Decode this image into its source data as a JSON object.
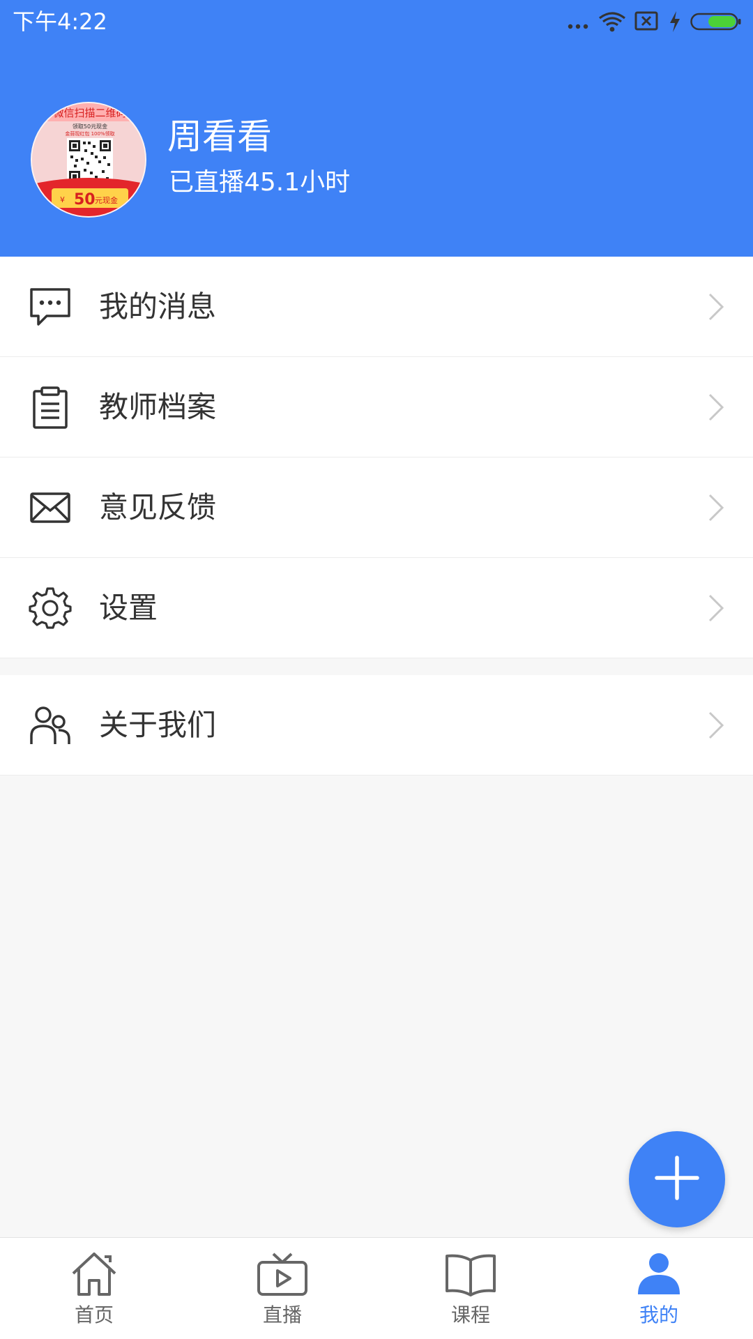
{
  "status_bar": {
    "time": "下午4:22",
    "icons": [
      "more-dots-icon",
      "wifi-icon",
      "no-sim-icon",
      "charging-icon",
      "battery-icon"
    ],
    "battery_color": "#4cd137"
  },
  "profile": {
    "name": "周看看",
    "live_hours": "已直播45.1小时",
    "avatar_icon": "qr-code-avatar-image",
    "avatar_texts": {
      "top_banner": "微信扫描二维码",
      "line1": "领取50元现金",
      "line2": "金蒜现红包  100%领取",
      "coupon_symbol": "¥",
      "coupon_amount": "50",
      "coupon_unit": "元现金"
    }
  },
  "menu": {
    "group1": [
      {
        "label": "我的消息",
        "icon": "message-icon"
      },
      {
        "label": "教师档案",
        "icon": "clipboard-icon"
      },
      {
        "label": "意见反馈",
        "icon": "envelope-icon"
      },
      {
        "label": "设置",
        "icon": "gear-icon"
      }
    ],
    "group2": [
      {
        "label": "关于我们",
        "icon": "users-icon"
      }
    ]
  },
  "fab": {
    "icon": "plus-icon"
  },
  "bottom_nav": {
    "items": [
      {
        "label": "首页",
        "icon": "home-icon"
      },
      {
        "label": "直播",
        "icon": "tv-play-icon"
      },
      {
        "label": "课程",
        "icon": "book-icon"
      },
      {
        "label": "我的",
        "icon": "person-icon",
        "active": true
      }
    ]
  },
  "colors": {
    "primary": "#3f82f6",
    "background": "#f7f7f7",
    "text": "#333333",
    "chevron": "#c8c8c8",
    "nav_inactive": "#666666"
  }
}
